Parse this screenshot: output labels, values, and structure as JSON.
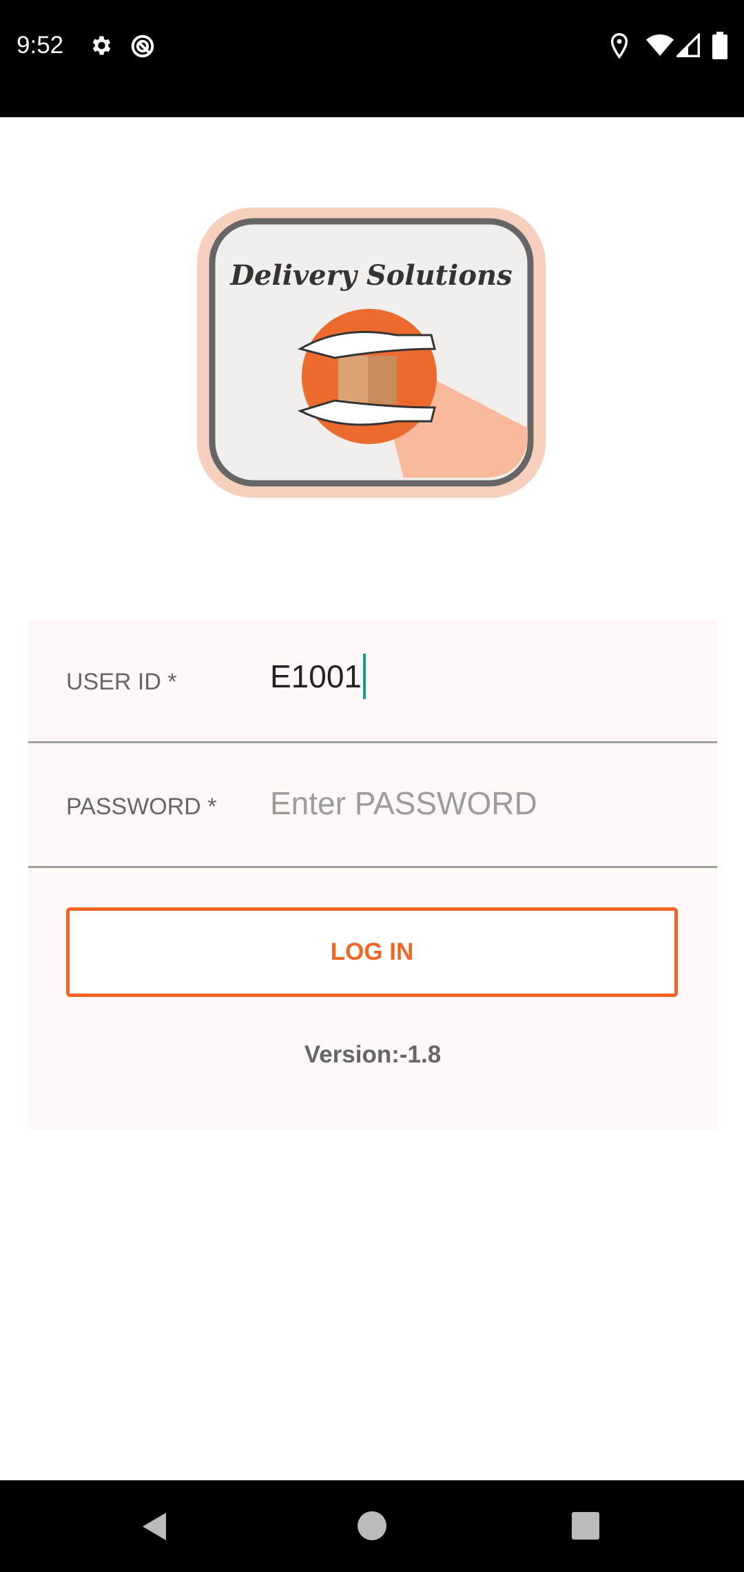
{
  "status_bar": {
    "time": "9:52",
    "icons_left": [
      "gear-icon",
      "do-not-disturb-icon"
    ],
    "icons_right": [
      "location-icon",
      "wifi-icon",
      "signal-icon",
      "battery-icon"
    ]
  },
  "logo": {
    "text": "Delivery Solutions",
    "colors": {
      "accent": "#f26522",
      "frame": "#666666"
    }
  },
  "form": {
    "user_id": {
      "label": "USER ID *",
      "value": "E1001"
    },
    "password": {
      "label": "PASSWORD *",
      "placeholder": "Enter PASSWORD",
      "value": ""
    },
    "login_label": "LOG IN",
    "version": "Version:-1.8"
  },
  "colors": {
    "accent": "#f26522",
    "caret": "#0f9d8a",
    "card_bg": "#fdf8f5"
  },
  "nav_bar": {
    "icons": [
      "back-icon",
      "home-icon",
      "recents-icon"
    ]
  }
}
